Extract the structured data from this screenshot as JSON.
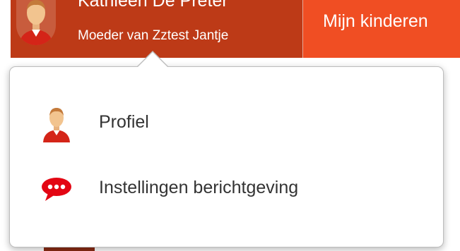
{
  "header": {
    "user_name": "Kathleen De Preter",
    "user_role": "Moeder van Zztest Jantje",
    "nav_tab_label": "Mijn kinderen"
  },
  "dropdown": {
    "items": [
      {
        "label": "Profiel",
        "icon": "user-profile-icon"
      },
      {
        "label": "Instellingen berichtgeving",
        "icon": "speech-bubble-icon"
      }
    ]
  },
  "colors": {
    "header_dark": "#bd3a17",
    "header_accent": "#f04e23",
    "notification_icon": "#e30613",
    "menu_text": "#333333"
  }
}
